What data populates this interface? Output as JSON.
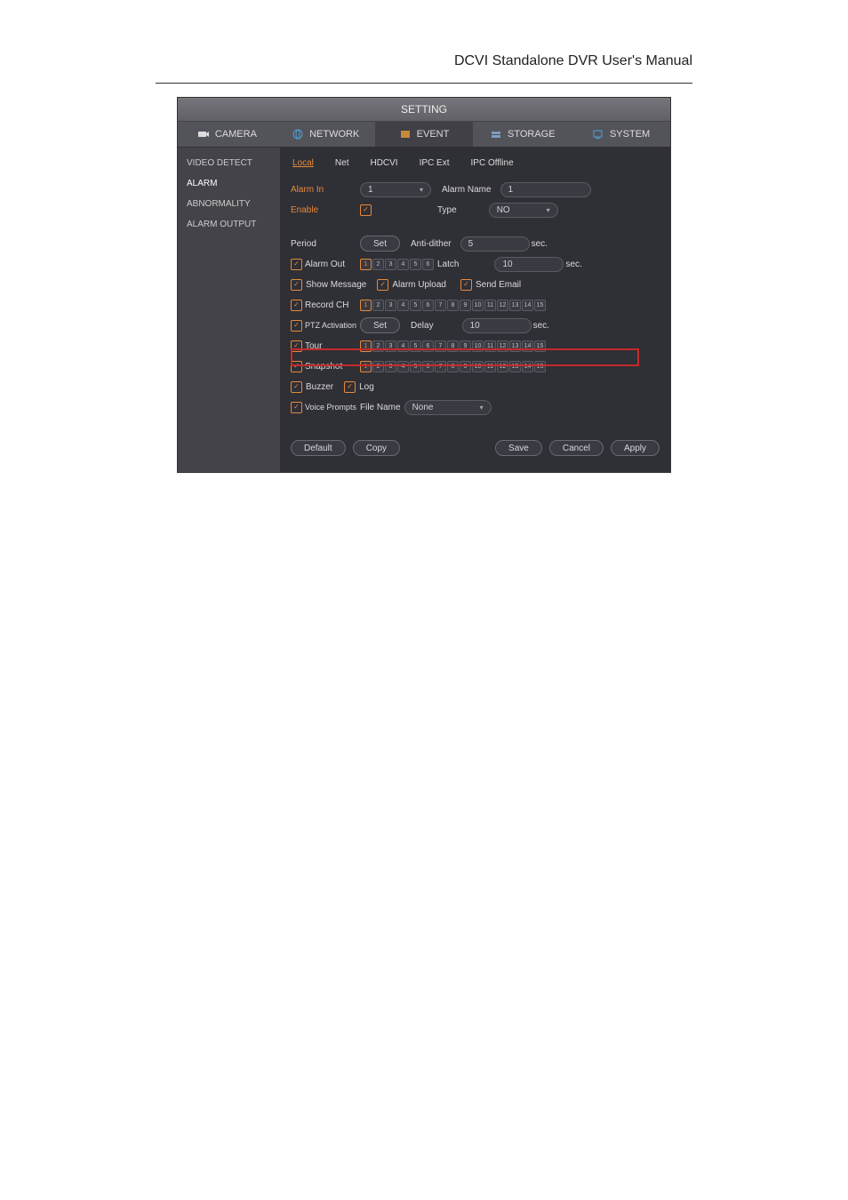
{
  "page_title": "DCVI Standalone DVR User's Manual",
  "window_title": "SETTING",
  "top_tabs": {
    "camera": "CAMERA",
    "network": "NETWORK",
    "event": "EVENT",
    "storage": "STORAGE",
    "system": "SYSTEM"
  },
  "sidebar": {
    "video_detect": "VIDEO DETECT",
    "alarm": "ALARM",
    "abnormality": "ABNORMALITY",
    "alarm_output": "ALARM OUTPUT"
  },
  "sub_tabs": {
    "local": "Local",
    "net": "Net",
    "hdcvi": "HDCVI",
    "ipc_ext": "IPC Ext",
    "ipc_offline": "IPC Offline"
  },
  "fields": {
    "alarm_in_label": "Alarm In",
    "alarm_in_value": "1",
    "alarm_name_label": "Alarm Name",
    "alarm_name_value": "1",
    "enable_label": "Enable",
    "type_label": "Type",
    "type_value": "NO",
    "period_label": "Period",
    "period_btn": "Set",
    "anti_dither_label": "Anti-dither",
    "anti_dither_value": "5",
    "sec": "sec.",
    "alarm_out_label": "Alarm Out",
    "latch_label": "Latch",
    "latch_value": "10",
    "show_message": "Show Message",
    "alarm_upload": "Alarm Upload",
    "send_email": "Send Email",
    "record_ch": "Record CH",
    "ptz_activation": "PTZ Activation",
    "ptz_btn": "Set",
    "delay_label": "Delay",
    "delay_value": "10",
    "tour": "Tour",
    "snapshot": "Snapshot",
    "buzzer": "Buzzer",
    "log": "Log",
    "voice_prompts": "Voice Prompts",
    "file_name_label": "File Name",
    "file_name_value": "None"
  },
  "footer": {
    "default": "Default",
    "copy": "Copy",
    "save": "Save",
    "cancel": "Cancel",
    "apply": "Apply"
  }
}
